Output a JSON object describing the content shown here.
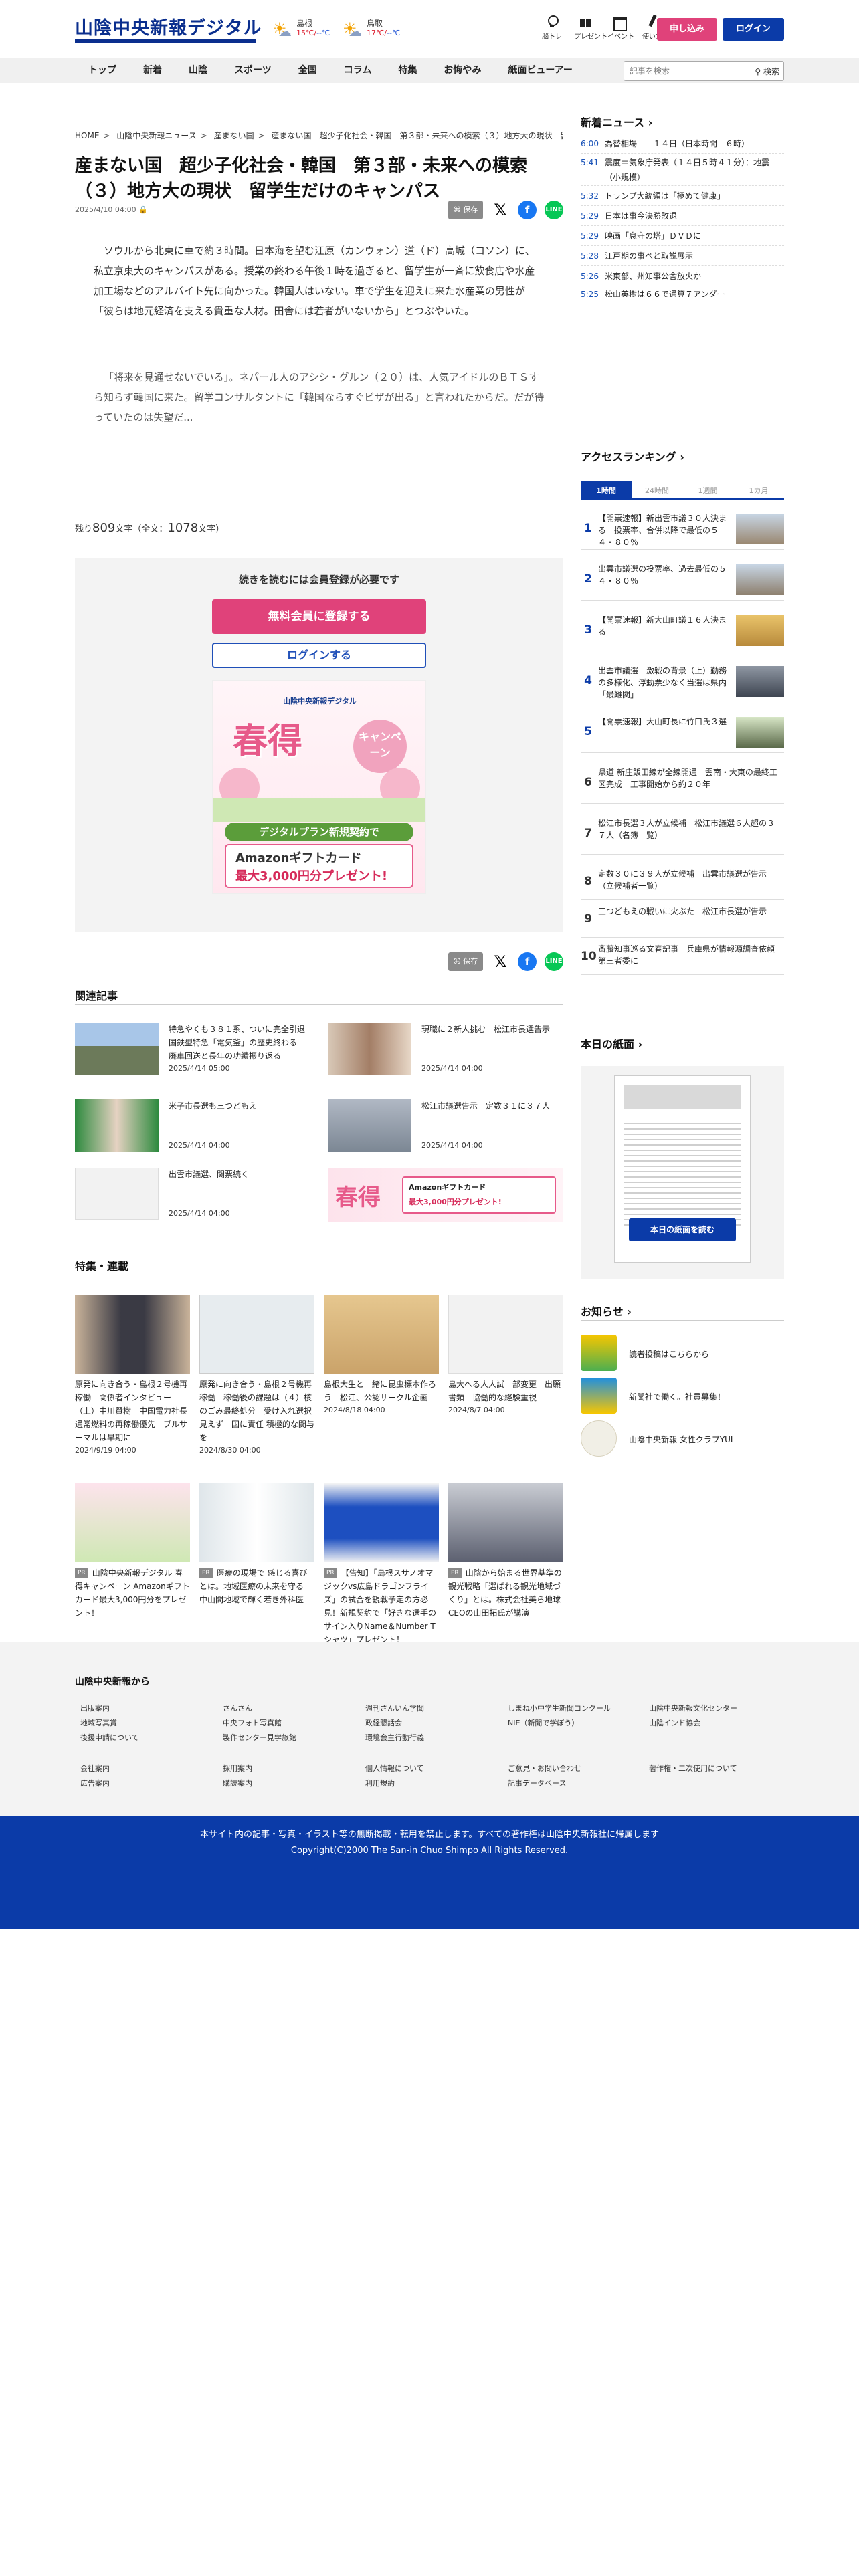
{
  "header": {
    "logo": "山陰中央新報デジタル",
    "weather": [
      {
        "city": "島根",
        "high": "15℃",
        "low": "--℃"
      },
      {
        "city": "鳥取",
        "high": "17℃",
        "low": "--℃"
      }
    ],
    "icons": [
      {
        "icon": "bulb-icon",
        "label": "脳トレ"
      },
      {
        "icon": "gift-icon",
        "label": "プレゼント"
      },
      {
        "icon": "calendar-icon",
        "label": "イベント"
      },
      {
        "icon": "pen-icon",
        "label": "使い方"
      }
    ],
    "signup": "申し込み",
    "login": "ログイン"
  },
  "nav": {
    "items": [
      "トップ",
      "新着",
      "山陰",
      "スポーツ",
      "全国",
      "コラム",
      "特集",
      "お悔やみ",
      "紙面ビューアー"
    ],
    "search_placeholder": "記事を検索",
    "search_button": "検索"
  },
  "article": {
    "breadcrumb": [
      "HOME",
      "山陰中央新報ニュース",
      "産まない国",
      "産まない国　超少子化社会・韓国　第３部・未来への模索（３）地方大の現状　留学..."
    ],
    "title": "産まない国　超少子化社会・韓国　第３部・未来への模索（３）地方大の現状　留学生だけのキャンパス",
    "date": "2025/4/10 04:00",
    "save": "保存",
    "paragraphs": [
      "ソウルから北東に車で約３時間。日本海を望む江原（カンウォン）道（ド）高城（コソン）に、私立京東大のキャンパスがある。授業の終わる午後１時を過ぎると、留学生が一斉に飲食店や水産加工場などのアルバイト先に向かった。韓国人はいない。車で学生を迎えに来た水産業の男性が「彼らは地元経済を支える貴重な人材。田舎には若者がいないから」とつぶやいた。",
      "「将来を見通せないでいる」。ネパール人のアシシ・グルン（２０）は、人気アイドルのＢＴＳすら知らず韓国に来た。留学コンサルタントに「韓国ならすぐビザが出る」と言われたからだ。だが待っていたのは失望だ..."
    ],
    "remaining_label": "残り",
    "remaining": "809",
    "chars_unit": "文字",
    "total_label": "（全文：",
    "total": "1078",
    "total_suffix": "文字）"
  },
  "paywall": {
    "message": "続きを読むには会員登録が必要です",
    "register": "無料会員に登録する",
    "login": "ログインする",
    "banner": {
      "brand": "山陰中央新報デジタル",
      "headline": "春得",
      "campaign": "キャンペーン",
      "strip": "デジタルプラン新規契約で",
      "gift": "Amazonギフトカード",
      "amount": "最大3,000円分プレゼント!"
    }
  },
  "related": {
    "heading": "関連記事",
    "items": [
      {
        "title": "特急やくも３８１系、ついに完全引退　国鉄型特急「電気釜」の歴史終わる　廃車回送と長年の功績振り返る",
        "date": "2025/4/14 05:00"
      },
      {
        "title": "現職に２新人挑む　松江市長選告示",
        "date": "2025/4/14 04:00"
      },
      {
        "title": "米子市長選も三つどもえ",
        "date": "2025/4/14 04:00"
      },
      {
        "title": "松江市議選告示　定数３１に３７人",
        "date": "2025/4/14 04:00"
      },
      {
        "title": "出雲市議選、関票続く",
        "date": "2025/4/14 04:00"
      }
    ]
  },
  "features": {
    "heading": "特集・連載",
    "items": [
      {
        "title": "原発に向き合う・島根２号機再稼働　関係者インタビュー（上）中川賢樹　中国電力社長　通常燃料の再稼働優先　プルサーマルは早期に",
        "date": "2024/9/19 04:00",
        "pr": ""
      },
      {
        "title": "原発に向き合う・島根２号機再稼働　稼働後の課題は（４）核のごみ最終処分　受け入れ選択見えず　国に責任 積極的な関与を",
        "date": "2024/8/30 04:00",
        "pr": ""
      },
      {
        "title": "島根大生と一緒に昆虫標本作ろう　松江、公認サークル企画",
        "date": "2024/8/18 04:00",
        "pr": ""
      },
      {
        "title": "島大へる人人試一部変更　出願書類　協働的な経験重視",
        "date": "2024/8/7 04:00",
        "pr": ""
      },
      {
        "title": "山陰中央新報デジタル 春得キャンペーン Amazonギフトカード最大3,000円分をプレゼント！",
        "date": "",
        "pr": "PR"
      },
      {
        "title": "医療の現場で 感じる喜びとは。地域医療の未来を守る　中山間地域で輝く若き外科医",
        "date": "",
        "pr": "PR"
      },
      {
        "title": "【告知】「島根スサノオマジックvs広島ドラゴンフライズ」の試合を観戦予定の方必見！新規契約で「好きな選手のサイン入りName＆Number Tシャツ」プレゼント！",
        "date": "",
        "pr": "PR"
      },
      {
        "title": "山陰から始まる世界基準の観光戦略「選ばれる観光地域づくり」とは。株式会社美ら地球CEOの山田拓氏が講演",
        "date": "",
        "pr": "PR"
      }
    ]
  },
  "sidebar": {
    "news_heading": "新着ニュース",
    "news": [
      {
        "time": "6:00",
        "title": "為替相場　　１４日（日本時間　６時）"
      },
      {
        "time": "5:41",
        "title": "震度＝気象庁発表（１４日５時４１分）：地震（小規模）"
      },
      {
        "time": "5:32",
        "title": "トランプ大統領は「極めて健康」"
      },
      {
        "time": "5:29",
        "title": "日本は事今決勝敗退"
      },
      {
        "time": "5:29",
        "title": "映画「息守の塔」ＤＶＤに"
      },
      {
        "time": "5:28",
        "title": "江戸期の事べと取説展示"
      },
      {
        "time": "5:26",
        "title": "米東部、州知事公舎放火か"
      },
      {
        "time": "5:25",
        "title": "松山英樹は６６で通算７アンダー"
      }
    ],
    "ranking_heading": "アクセスランキング",
    "ranking_tabs": [
      "1時間",
      "24時間",
      "1週間",
      "1カ月"
    ],
    "ranking": [
      {
        "rank": "1",
        "title": "【開票速報】新出雲市議３０人決まる　投票率、合併以降で最低の５４・８０％"
      },
      {
        "rank": "2",
        "title": "出雲市議選の投票率、過去最低の５４・８０％"
      },
      {
        "rank": "3",
        "title": "【開票速報】新大山町議１６人決まる"
      },
      {
        "rank": "4",
        "title": "出雲市議選　激戦の背景（上）勤務の多様化、浮動票少なく当選は県内「最難関」"
      },
      {
        "rank": "5",
        "title": "【開票速報】大山町長に竹口氏３選"
      },
      {
        "rank": "6",
        "title": "県道 新庄飯田線が全線開通　雲南・大東の最終工区完成　工事開始から約２０年"
      },
      {
        "rank": "7",
        "title": "松江市長選３人が立候補　松江市議選６人超の３７人（名簿一覧）"
      },
      {
        "rank": "8",
        "title": "定数３０に３９人が立候補　出雲市議選が告示（立候補者一覧）"
      },
      {
        "rank": "9",
        "title": "三つどもえの戦いに火ぶた　松江市長選が告示"
      },
      {
        "rank": "10",
        "title": "斎藤知事巡る文春記事　兵庫県が情報源調査依頼　第三者委に"
      }
    ],
    "paper_heading": "本日の紙面",
    "paper_button": "本日の紙面を読む",
    "notices_heading": "お知らせ",
    "notices": [
      "読者投稿はこちらから",
      "新聞社で働く。社員募集！",
      "山陰中央新報 女性クラブYUI"
    ]
  },
  "footer": {
    "heading": "山陰中央新報から",
    "links": [
      [
        "出版案内",
        "さんさん",
        "週刊さんいん学聞",
        "しまね小中学生新聞コンクール",
        "山陰中央新報文化センター"
      ],
      [
        "地域写真賞",
        "中央フォト写真館",
        "政経懇話会",
        "NIE（新聞で学ぼう）",
        "山陰インド協会"
      ],
      [
        "後援申請について",
        "製作センター見学旅館",
        "環境会主行動行義",
        "",
        ""
      ],
      [
        "会社案内",
        "採用案内",
        "個人情報について",
        "ご意見・お問い合わせ",
        "著作権・二次使用について"
      ],
      [
        "広告案内",
        "購読案内",
        "利用規約",
        "記事データベース",
        ""
      ]
    ],
    "notice": "本サイト内の記事・写真・イラスト等の無断掲載・転用を禁止します。すべての著作権は山陰中央新報社に帰属します",
    "copyright": "Copyright(C)2000 The San-in Chuo Shimpo All Rights Reserved."
  }
}
